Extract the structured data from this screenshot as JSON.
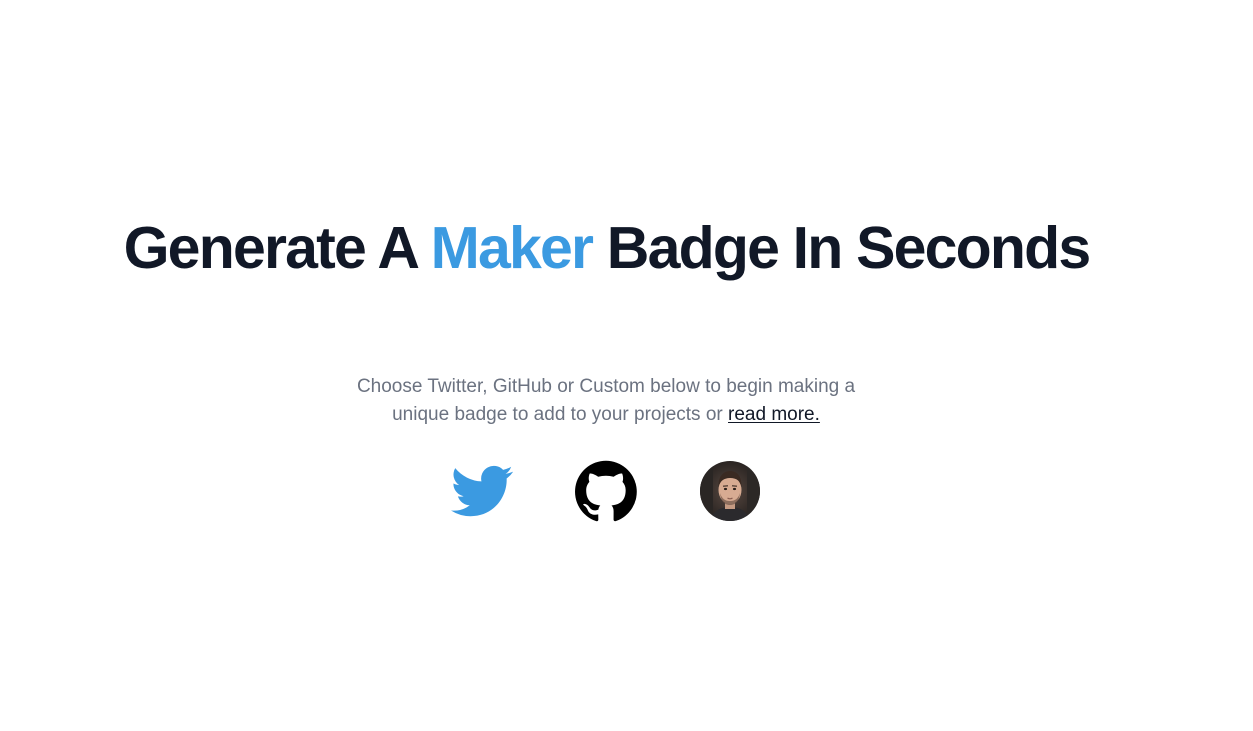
{
  "hero": {
    "title_part1": "Generate A ",
    "title_accent": "Maker",
    "title_part2": " Badge In Seconds",
    "subtitle": "Choose Twitter, GitHub or Custom below to begin making a unique badge to add to your projects or ",
    "read_more": "read more."
  },
  "choices": [
    {
      "label": "Twitter",
      "icon": "twitter-icon"
    },
    {
      "label": "GitHub",
      "icon": "github-icon"
    },
    {
      "label": "Custom",
      "icon": "avatar-photo"
    }
  ],
  "colors": {
    "heading": "#111827",
    "accent": "#3b9ae1",
    "body_text": "#6b7280",
    "twitter_blue": "#3b9ae1",
    "github_black": "#000000"
  }
}
